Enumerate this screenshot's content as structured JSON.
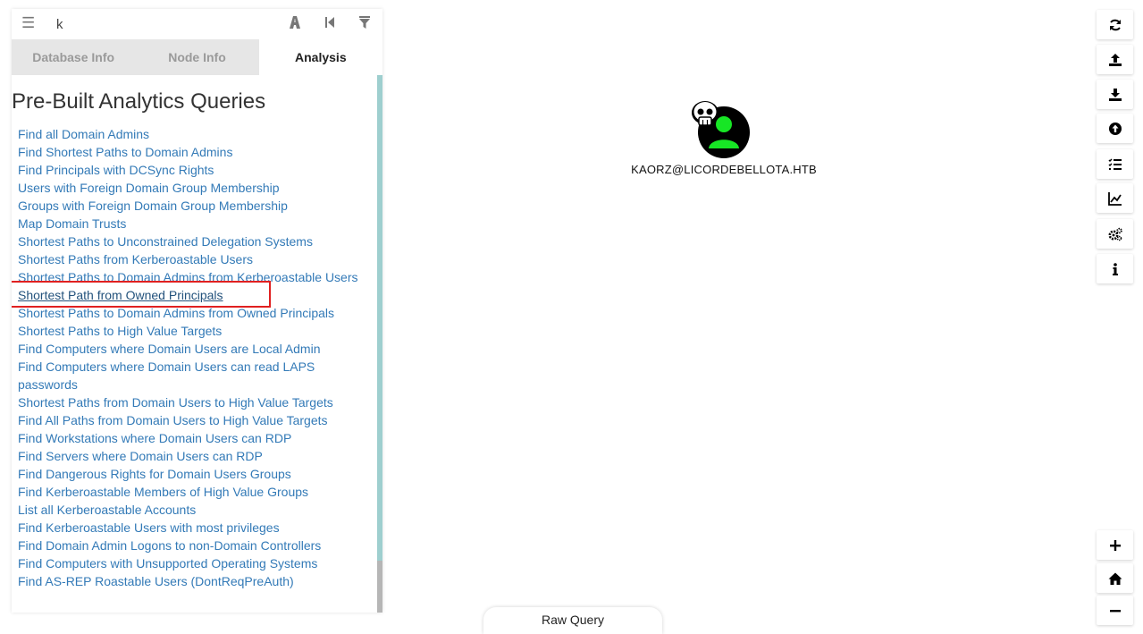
{
  "search": {
    "value": "k"
  },
  "tabs": [
    {
      "label": "Database Info",
      "active": false
    },
    {
      "label": "Node Info",
      "active": false
    },
    {
      "label": "Analysis",
      "active": true
    }
  ],
  "analysis": {
    "heading": "Pre-Built Analytics Queries",
    "queries": [
      "Find all Domain Admins",
      "Find Shortest Paths to Domain Admins",
      "Find Principals with DCSync Rights",
      "Users with Foreign Domain Group Membership",
      "Groups with Foreign Domain Group Membership",
      "Map Domain Trusts",
      "Shortest Paths to Unconstrained Delegation Systems",
      "Shortest Paths from Kerberoastable Users",
      "Shortest Paths to Domain Admins from Kerberoastable Users",
      "Shortest Path from Owned Principals",
      "Shortest Paths to Domain Admins from Owned Principals",
      "Shortest Paths to High Value Targets",
      "Find Computers where Domain Users are Local Admin",
      "Find Computers where Domain Users can read LAPS passwords",
      "Shortest Paths from Domain Users to High Value Targets",
      "Find All Paths from Domain Users to High Value Targets",
      "Find Workstations where Domain Users can RDP",
      "Find Servers where Domain Users can RDP",
      "Find Dangerous Rights for Domain Users Groups",
      "Find Kerberoastable Members of High Value Groups",
      "List all Kerberoastable Accounts",
      "Find Kerberoastable Users with most privileges",
      "Find Domain Admin Logons to non-Domain Controllers",
      "Find Computers with Unsupported Operating Systems",
      "Find AS-REP Roastable Users (DontReqPreAuth)"
    ],
    "highlighted_query": "Shortest Path from Owned Principals"
  },
  "graph": {
    "node_label": "KAORZ@LICORDEBELLOTA.HTB",
    "node_type": "user",
    "owned": true,
    "node_color": "#17e625"
  },
  "toolbar": {
    "icons": [
      "refresh-icon",
      "upload-icon",
      "download-icon",
      "import-icon",
      "queries-icon",
      "chart-icon",
      "settings-icon",
      "info-icon"
    ]
  },
  "zoom": {
    "icons": [
      "zoom-in-icon",
      "home-icon",
      "zoom-out-icon"
    ]
  },
  "raw_query": {
    "label": "Raw Query"
  },
  "colors": {
    "link": "#337ab7",
    "highlight_box": "#e02020",
    "tab_inactive_bg": "#e6e6e6",
    "scroll_thumb": "#9ecfcf"
  }
}
